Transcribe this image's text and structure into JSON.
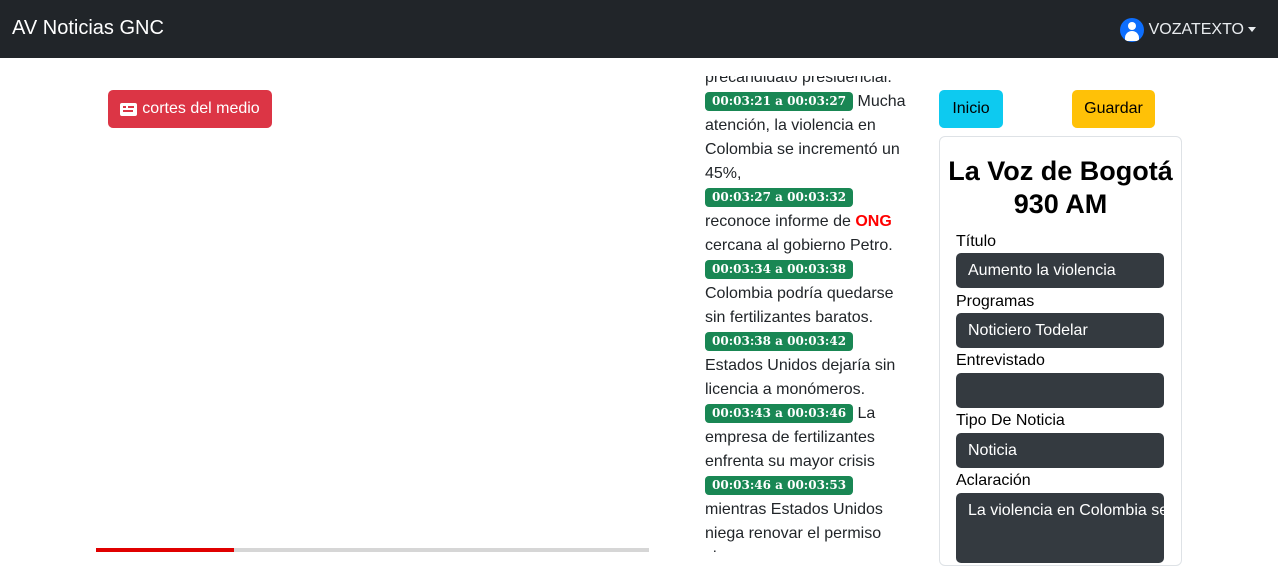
{
  "navbar": {
    "brand": "AV Noticias GNC",
    "user": "VOZATEXTO"
  },
  "player": {
    "cortes_button": "cortes del medio",
    "progress": 0.25
  },
  "transcript": {
    "intro_text": "precandidato presidencial.",
    "segments": [
      {
        "time": "00:03:21 a 00:03:27",
        "text": "Mucha atención, la violencia en Colombia se incrementó un 45%,"
      },
      {
        "time": "00:03:27 a 00:03:32",
        "text_before": "reconoce informe de",
        "keyword": "ONG",
        "text_after": "cercana al gobierno Petro."
      },
      {
        "time": "00:03:34 a 00:03:38",
        "text": "Colombia podría quedarse sin fertilizantes baratos."
      },
      {
        "time": "00:03:38 a 00:03:42",
        "text": "Estados Unidos dejaría sin licencia a monómeros."
      },
      {
        "time": "00:03:43 a 00:03:46",
        "text": "La empresa de fertilizantes enfrenta su mayor crisis"
      },
      {
        "time": "00:03:46 a 00:03:53",
        "text": "mientras Estados Unidos niega renovar el permiso clave"
      }
    ]
  },
  "actions": {
    "inicio": "Inicio",
    "guardar": "Guardar"
  },
  "form": {
    "station": "La Voz de Bogotá 930 AM",
    "titulo_label": "Título",
    "titulo_value": "Aumento la violencia",
    "programas_label": "Programas",
    "programas_value": "Noticiero Todelar",
    "entrevistado_label": "Entrevistado",
    "entrevistado_value": "",
    "tipo_label": "Tipo De Noticia",
    "tipo_value": "Noticia",
    "aclaracion_label": "Aclaración",
    "aclaracion_value": "La violencia en Colombia se incrementó"
  },
  "colors": {
    "navbar": "#212529",
    "danger": "#dc3545",
    "success": "#198754",
    "info": "#0dcaf0",
    "warning": "#ffc107",
    "input_dark": "#343a40",
    "progress": "#e00000"
  },
  "icons": {
    "user": "user-circle-icon",
    "captions": "closed-captioning-icon",
    "dropdown": "chevron-down-icon"
  }
}
